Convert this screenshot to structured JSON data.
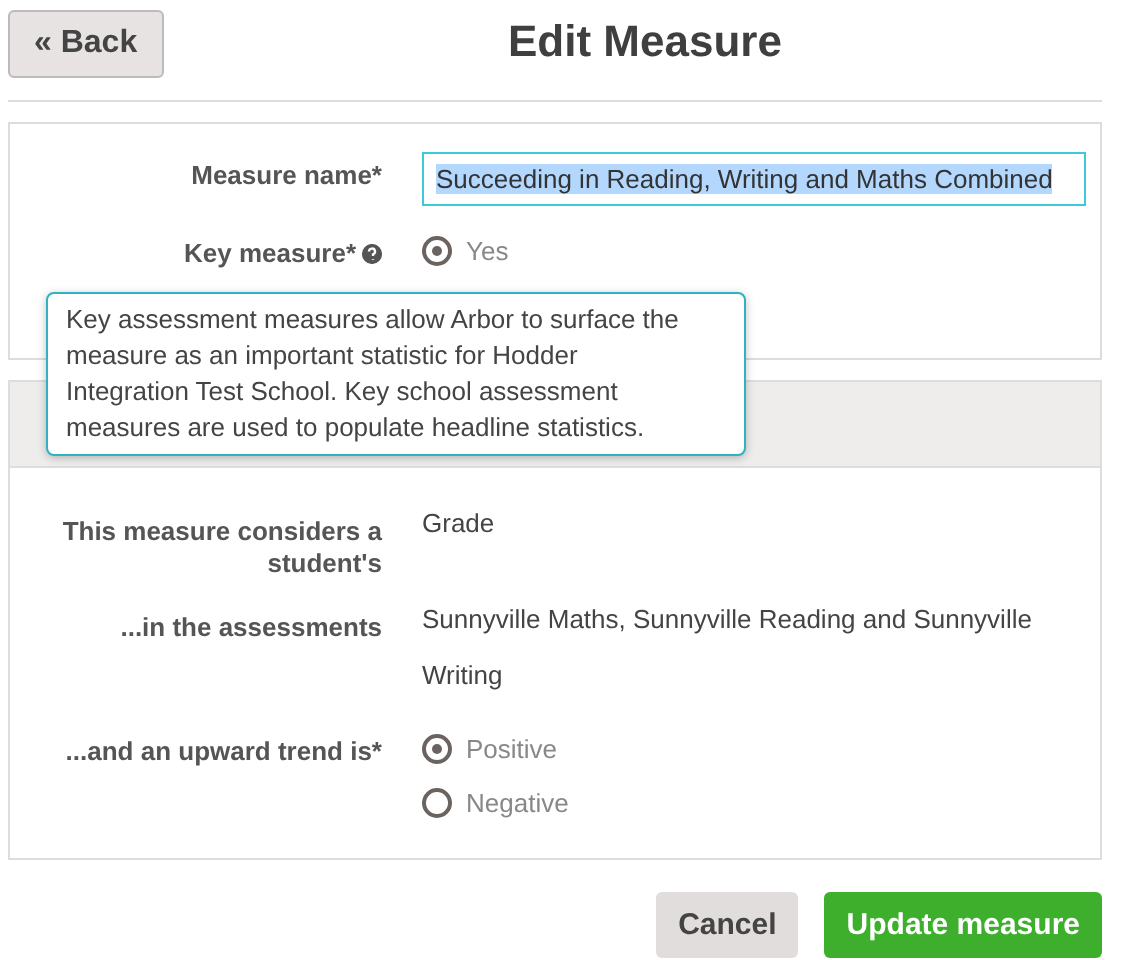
{
  "header": {
    "back_button": "« Back",
    "title": "Edit Measure"
  },
  "details": {
    "measure_name": {
      "label": "Measure name*",
      "value": "Succeeding in Reading, Writing and Maths Combined"
    },
    "key_measure": {
      "label": "Key measure*",
      "options": [
        {
          "label": "Yes",
          "selected": true
        }
      ]
    }
  },
  "tooltip": "Key assessment measures allow Arbor to surface the measure as an important statistic for Hodder Integration Test School. Key school assessment measures are used to populate headline statistics.",
  "section": {
    "rows": [
      {
        "kind": "text",
        "label": "This measure considers a student's",
        "value": "Grade"
      },
      {
        "kind": "text",
        "label": "...in the assessments",
        "value": "Sunnyville Maths, Sunnyville Reading and Sunnyville Writing"
      },
      {
        "kind": "radio",
        "label": "...and an upward trend is*",
        "options": [
          {
            "label": "Positive",
            "selected": true
          },
          {
            "label": "Negative",
            "selected": false
          }
        ]
      }
    ]
  },
  "buttons": [
    {
      "kind": "secondary",
      "label": "Cancel"
    },
    {
      "kind": "primary",
      "label": "Update measure"
    }
  ]
}
